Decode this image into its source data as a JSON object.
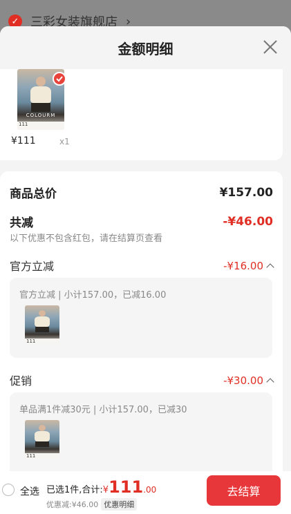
{
  "background": {
    "store_name": "三彩女装旗舰店"
  },
  "sheet": {
    "title": "金额明细"
  },
  "item": {
    "brand_text": "COLOURM",
    "tag": "111",
    "price": "¥111",
    "quantity": "x1"
  },
  "totals": {
    "goods_total_label": "商品总价",
    "goods_total_value": "¥157.00",
    "reduction_label": "共减",
    "reduction_value": "-¥46.00",
    "reduction_note": "以下优惠不包含红包，请在结算页查看"
  },
  "sections": [
    {
      "label": "官方立减",
      "value": "-¥16.00",
      "detail": "官方立减 | 小计157.00，已减16.00"
    },
    {
      "label": "促销",
      "value": "-¥30.00",
      "detail": "单品满1件减30元 | 小计157.00，已减30"
    }
  ],
  "footer": {
    "select_all": "全选",
    "selected_summary": "已选1件,合计:",
    "currency": "¥",
    "amount_int": "111",
    "amount_dec": ".00",
    "discount_text": "优惠减:¥46.00",
    "detail_button": "优惠明细",
    "checkout_button": "去结算"
  },
  "colors": {
    "accent_red": "#e02e24",
    "checkout_red": "#e8373a"
  }
}
